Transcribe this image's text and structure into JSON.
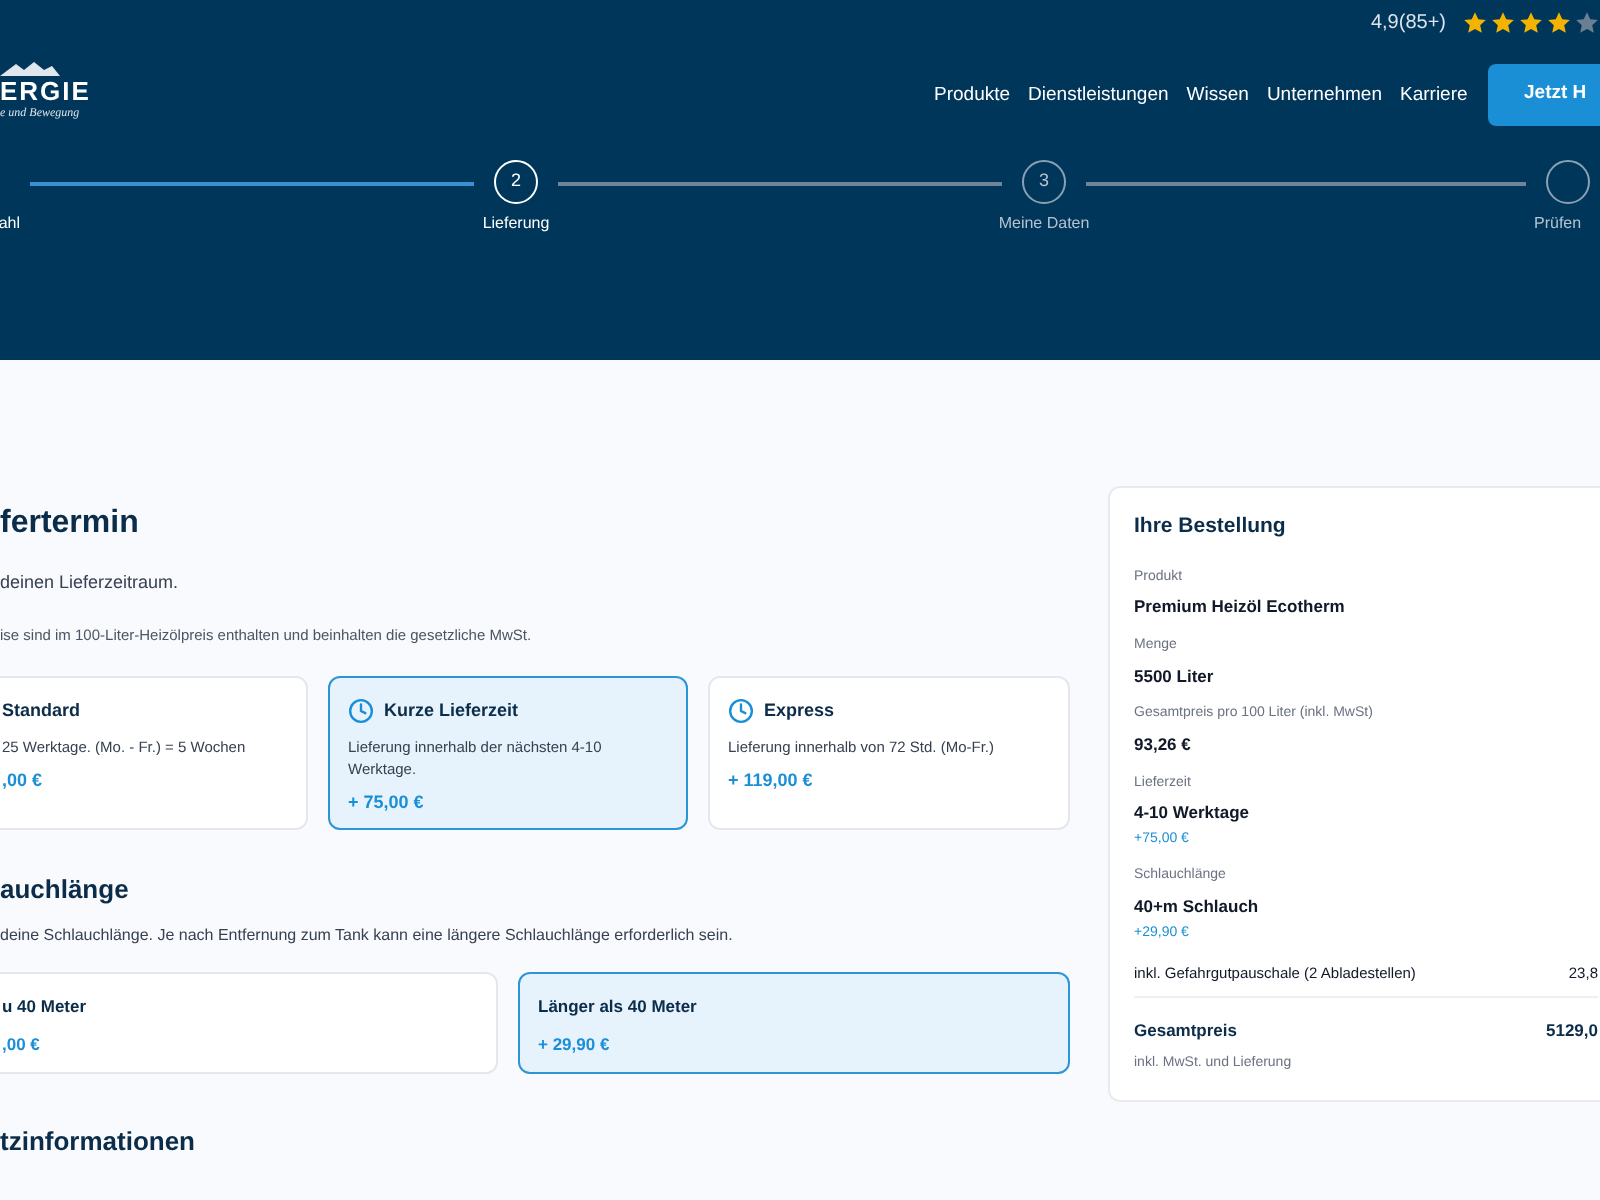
{
  "header": {
    "logo": {
      "name": "ERGIE",
      "tagline": "e und Bewegung"
    },
    "rating": {
      "score": "4,9(85+)",
      "stars": 4
    },
    "nav": [
      "Produkte",
      "Dienstleistungen",
      "Wissen",
      "Unternehmen",
      "Karriere"
    ],
    "cta": "Jetzt H"
  },
  "stepper": [
    {
      "label": "ahl",
      "reached": true
    },
    {
      "number": "2",
      "label": "Lieferung",
      "reached": true
    },
    {
      "number": "3",
      "label": "Meine Daten",
      "reached": false
    },
    {
      "label": "Prüfen",
      "reached": false
    }
  ],
  "delivery": {
    "title": "fertermin",
    "subtitle": "deinen Lieferzeitraum.",
    "note": "ise sind im 100-Liter-Heizölpreis enthalten und beinhalten die gesetzliche MwSt.",
    "options": [
      {
        "title": "Standard",
        "description": "25 Werktage. (Mo. - Fr.) = 5 Wochen",
        "price": ",00 €",
        "selected": false,
        "icon": false
      },
      {
        "title": "Kurze Lieferzeit",
        "description": "Lieferung innerhalb der nächsten 4-10 Werktage.",
        "price": "+ 75,00 €",
        "selected": true,
        "icon": true
      },
      {
        "title": "Express",
        "description": "Lieferung innerhalb von 72 Std. (Mo-Fr.)",
        "price": "+ 119,00 €",
        "selected": false,
        "icon": true
      }
    ]
  },
  "hose": {
    "title": "auchlänge",
    "subtitle": "deine Schlauchlänge. Je nach Entfernung zum Tank kann eine längere Schlauchlänge erforderlich sein.",
    "options": [
      {
        "title": "u 40 Meter",
        "price": ",00 €",
        "selected": false
      },
      {
        "title": "Länger als 40 Meter",
        "price": "+ 29,90 €",
        "selected": true
      }
    ]
  },
  "additional": {
    "title": "tzinformationen"
  },
  "order": {
    "title": "Ihre Bestellung",
    "items": [
      {
        "label": "Produkt",
        "value": "Premium Heizöl Ecotherm"
      },
      {
        "label": "Menge",
        "value": "5500 Liter"
      },
      {
        "label": "Gesamtpreis pro 100 Liter (inkl. MwSt)",
        "value": "93,26 €"
      },
      {
        "label": "Lieferzeit",
        "value": "4-10 Werktage",
        "extra": "+75,00 €"
      },
      {
        "label": "Schlauchlänge",
        "value": "40+m Schlauch",
        "extra": "+29,90 €"
      }
    ],
    "fee": {
      "label": "inkl. Gefahrgutpauschale (2 Abladestellen)",
      "amount": "23,8"
    },
    "total": {
      "label": "Gesamtpreis",
      "amount": "5129,0",
      "note": "inkl. MwSt. und Lieferung"
    }
  }
}
